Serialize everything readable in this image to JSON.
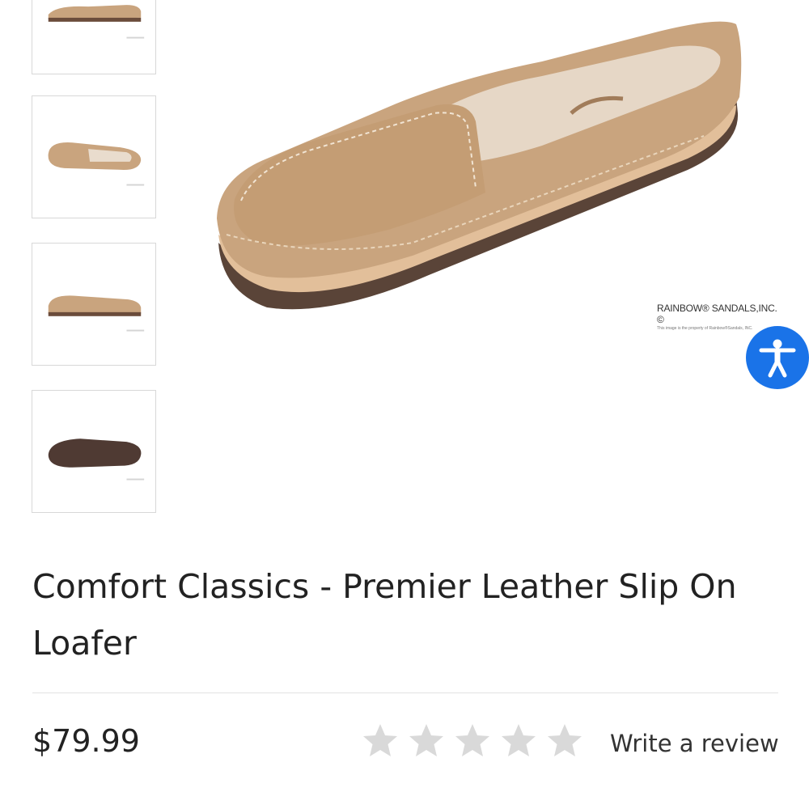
{
  "gallery": {
    "thumbnails": [
      {
        "icon": "shoe-side-view-image"
      },
      {
        "icon": "shoe-top-view-image"
      },
      {
        "icon": "shoe-profile-view-image"
      },
      {
        "icon": "shoe-sole-view-image"
      }
    ],
    "main_image": {
      "icon": "shoe-angled-view-image",
      "watermark_brand": "RAINBOW® SANDALS,INC. ©",
      "watermark_note": "This image is the property of Rainbow®Sandals, INC."
    }
  },
  "accessibility": {
    "icon": "accessibility-icon",
    "color": "#1a73e8"
  },
  "product": {
    "title": "Comfort Classics - Premier Leather Slip On Loafer",
    "price": "$79.99",
    "rating": {
      "value": 0,
      "max": 5,
      "star_color": "#d9d9d9"
    },
    "review_label": "Write a review"
  },
  "colors": {
    "leather": "#c9a47e",
    "sole": "#5a4438",
    "accent": "#1a73e8"
  }
}
